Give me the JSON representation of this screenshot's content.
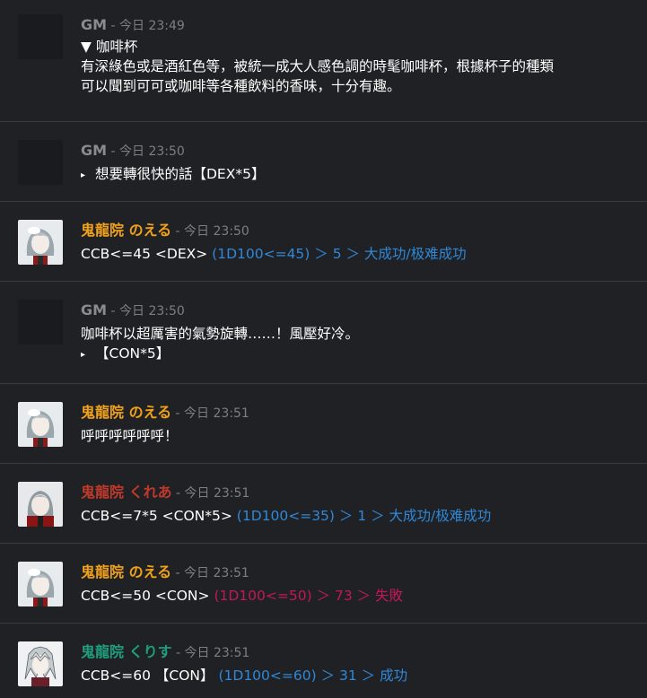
{
  "colors": {
    "background": "#202124",
    "divider": "#3a3b3e",
    "timestamp": "#7d7e81",
    "gm": "#8a8b8e",
    "noeru": "#f0a11a",
    "kurea": "#c0392b",
    "kurisu": "#1f9e7d",
    "roll_blue": "#2f88d8",
    "roll_red": "#c2185b"
  },
  "messages": [
    {
      "name": "GM",
      "time": "- 今日 23:49",
      "lines": [
        "▼ 咖啡杯",
        "有深綠色或是酒紅色等，被統一成大人感色調的時髦咖啡杯，根據杯子的種類可以聞到可可或咖啡等各種飲料的香味，十分有趣。"
      ]
    },
    {
      "name": "GM",
      "time": "- 今日 23:50",
      "tri": "▸",
      "lines": [
        "想要轉很快的話【DEX*5】"
      ]
    },
    {
      "name": "鬼龍院 のえる",
      "time": "- 今日 23:50",
      "cmd": "CCB<=45 <DEX>",
      "roll": "(1D100<=45) ＞ 5 ＞ 大成功/极难成功"
    },
    {
      "name": "GM",
      "time": "- 今日 23:50",
      "tri": "▸",
      "lines": [
        "咖啡杯以超厲害的氣勢旋轉……！風壓好冷。",
        "【CON*5】"
      ]
    },
    {
      "name": "鬼龍院 のえる",
      "time": "- 今日 23:51",
      "lines": [
        "呼呼呼呼呼呼！"
      ]
    },
    {
      "name": "鬼龍院 くれあ",
      "time": "- 今日 23:51",
      "cmd": "CCB<=7*5 <CON*5>",
      "roll": "(1D100<=35) ＞ 1 ＞ 大成功/极难成功"
    },
    {
      "name": "鬼龍院 のえる",
      "time": "- 今日 23:51",
      "cmd": "CCB<=50 <CON>",
      "roll": "(1D100<=50) ＞ 73 ＞ 失敗"
    },
    {
      "name": "鬼龍院 くりす",
      "time": "- 今日 23:51",
      "cmd": "CCB<=60 【CON】",
      "roll": "(1D100<=60) ＞ 31 ＞ 成功"
    }
  ]
}
